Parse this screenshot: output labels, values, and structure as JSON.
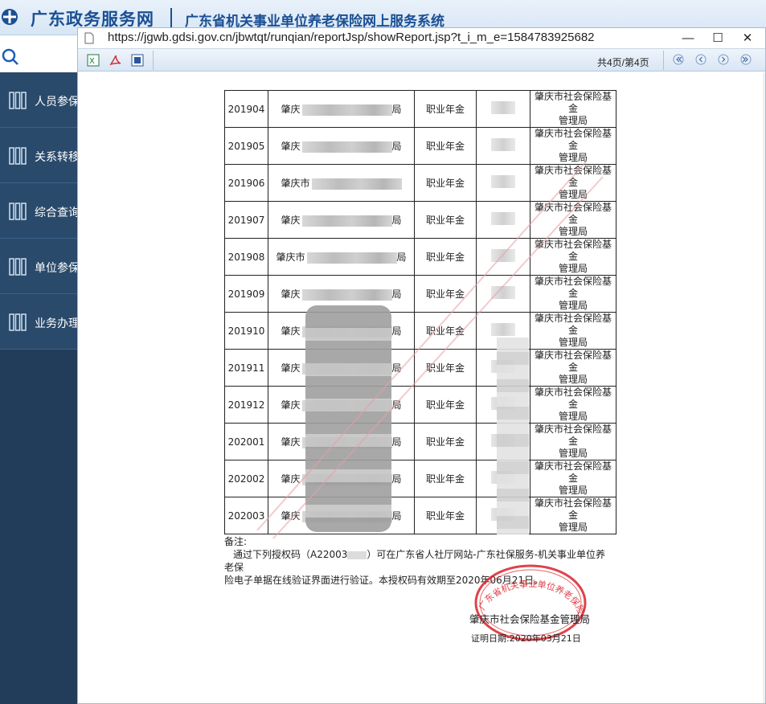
{
  "app": {
    "brand": "广东政务服务网",
    "title": "广东省机关事业单位养老保险网上服务系统"
  },
  "sidebar": {
    "items": [
      {
        "label": "人员参保"
      },
      {
        "label": "关系转移"
      },
      {
        "label": "综合查询"
      },
      {
        "label": "单位参保"
      },
      {
        "label": "业务办理"
      }
    ]
  },
  "popup": {
    "url": "https://jgwb.gdsi.gov.cn/jbwtqt/runqian/reportJsp/showReport.jsp?t_i_m_e=1584783925682",
    "page_count": "共4页/第4页",
    "window_controls": {
      "minimize": "—",
      "maximize": "☐",
      "close": "✕"
    }
  },
  "report": {
    "rows": [
      {
        "month": "201904",
        "unit_prefix": "肇庆",
        "unit_suffix": "局",
        "type": "职业年金",
        "org": [
          "肇庆市社会保险基",
          "金",
          "管理局"
        ]
      },
      {
        "month": "201905",
        "unit_prefix": "肇庆",
        "unit_suffix": "局",
        "type": "职业年金",
        "org": [
          "肇庆市社会保险基",
          "金",
          "管理局"
        ]
      },
      {
        "month": "201906",
        "unit_prefix": "肇庆市",
        "unit_suffix": "",
        "type": "职业年金",
        "org": [
          "肇庆市社会保险基",
          "金",
          "管理局"
        ]
      },
      {
        "month": "201907",
        "unit_prefix": "肇庆",
        "unit_suffix": "局",
        "type": "职业年金",
        "org": [
          "肇庆市社会保险基",
          "金",
          "管理局"
        ]
      },
      {
        "month": "201908",
        "unit_prefix": "肇庆市",
        "unit_suffix": "局",
        "type": "职业年金",
        "org": [
          "肇庆市社会保险基",
          "金",
          "管理局"
        ]
      },
      {
        "month": "201909",
        "unit_prefix": "肇庆",
        "unit_suffix": "局",
        "type": "职业年金",
        "org": [
          "肇庆市社会保险基",
          "金",
          "管理局"
        ]
      },
      {
        "month": "201910",
        "unit_prefix": "肇庆",
        "unit_suffix": "局",
        "type": "职业年金",
        "org": [
          "肇庆市社会保险基",
          "金",
          "管理局"
        ]
      },
      {
        "month": "201911",
        "unit_prefix": "肇庆",
        "unit_suffix": "局",
        "type": "职业年金",
        "org": [
          "肇庆市社会保险基",
          "金",
          "管理局"
        ]
      },
      {
        "month": "201912",
        "unit_prefix": "肇庆",
        "unit_suffix": "局",
        "type": "职业年金",
        "org": [
          "肇庆市社会保险基",
          "金",
          "管理局"
        ]
      },
      {
        "month": "202001",
        "unit_prefix": "肇庆",
        "unit_suffix": "局",
        "type": "职业年金",
        "org": [
          "肇庆市社会保险基",
          "金",
          "管理局"
        ]
      },
      {
        "month": "202002",
        "unit_prefix": "肇庆",
        "unit_suffix": "局",
        "type": "职业年金",
        "org": [
          "肇庆市社会保险基",
          "金",
          "管理局"
        ]
      },
      {
        "month": "202003",
        "unit_prefix": "肇庆",
        "unit_suffix": "局",
        "type": "职业年金",
        "org": [
          "肇庆市社会保险基",
          "金",
          "管理局"
        ]
      }
    ],
    "remark_title": "备注:",
    "remark_line1": "通过下列授权码（A22003",
    "remark_line1_end": "）可在广东省人社厅网站-广东社保服务-机关事业单位养",
    "remark_line2": "老保",
    "remark_line3": "险电子单据在线验证界面进行验证。本授权码有效期至2020年06月21日。",
    "signature": "肇庆市社会保险基金管理局",
    "date": "证明日期:2020年03月21日",
    "seal_text": "广东省机关事业单位养老保险"
  },
  "colors": {
    "sidebar_bg": "#223d5a",
    "brand_blue": "#1a4f93",
    "seal_red": "#d8222a"
  }
}
